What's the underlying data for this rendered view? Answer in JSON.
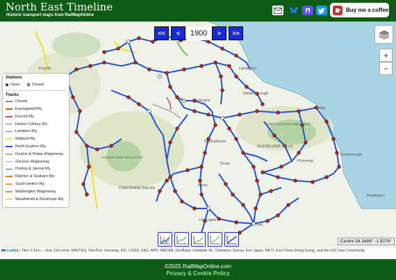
{
  "header": {
    "title": "North East Timeline",
    "subtitle": "Historic transport maps from RailMapOnline",
    "coffee_label": "Buy me a coffee",
    "social_icons": [
      "email-icon",
      "bluesky-icon",
      "mastodon-icon",
      "twitter-icon"
    ]
  },
  "timeline": {
    "first_label": "<<",
    "prev_label": "<",
    "year": "1900",
    "next_label": ">",
    "last_label": ">>"
  },
  "legend": {
    "stations_heading": "Stations",
    "open_label": "Open",
    "closed_label": "Closed",
    "tracks_heading": "Tracks",
    "tracks": [
      {
        "name": "Closed",
        "color": "#888888"
      },
      {
        "name": "Easingwold Rly",
        "color": "#c06000"
      },
      {
        "name": "Forcett Rly",
        "color": "#e0309a"
      },
      {
        "name": "Hetton Colliery Rly",
        "color": "#40b040"
      },
      {
        "name": "Lambton Rly",
        "color": "#20a070"
      },
      {
        "name": "Midland Rly",
        "color": "#f2e21a"
      },
      {
        "name": "North Eastern Rly",
        "color": "#2050d8"
      },
      {
        "name": "Ouston & Pelaw Wagonway",
        "color": "#d8a080"
      },
      {
        "name": "Oxclose Wagonway",
        "color": "#a0a0c0"
      },
      {
        "name": "Pontop & Jarrow Rly",
        "color": "#208080"
      },
      {
        "name": "Rainton & Seaham Rly",
        "color": "#e08020"
      },
      {
        "name": "South Hetton Rly",
        "color": "#f0a040"
      },
      {
        "name": "Washington Wagonway",
        "color": "#c0a030"
      },
      {
        "name": "Weatherhill & Rockhope Rly",
        "color": "#e0b000"
      }
    ]
  },
  "map": {
    "centre_readout": "Centre 54.3486° -1.5076°",
    "place_labels": [
      "Darlington",
      "Middlesbrough",
      "Whitby",
      "Scarborough",
      "Thirsk",
      "Ripon",
      "Harrogate",
      "York",
      "Pickering",
      "Bridlington",
      "CLEVELAND HILLS",
      "North York Moors National Park",
      "YORKSHIRE DALES",
      "Yorkshire Dales National Park",
      "Northallerton",
      "Hartlepool",
      "Penrith"
    ]
  },
  "attribution": {
    "leaflet_label": "Leaflet",
    "text": "| Tiles © Esri — Esri, DeLorme, NAVTEQ, TomTom, Intermap, iPC, USGS, FAO, NPS, NRCAN, GeoBase, Kadaster NL, Ordnance Survey, Esri Japan, METI, Esri China (Hong Kong), and the GIS User Community"
  },
  "footer": {
    "copyright": "©2025 RailMapOnline.com",
    "privacy": "Privacy & Cookie Policy"
  },
  "colors": {
    "brand_green": "#0f5c16",
    "nav_blue": "#1a2ad8",
    "station_open": "#d21818"
  }
}
